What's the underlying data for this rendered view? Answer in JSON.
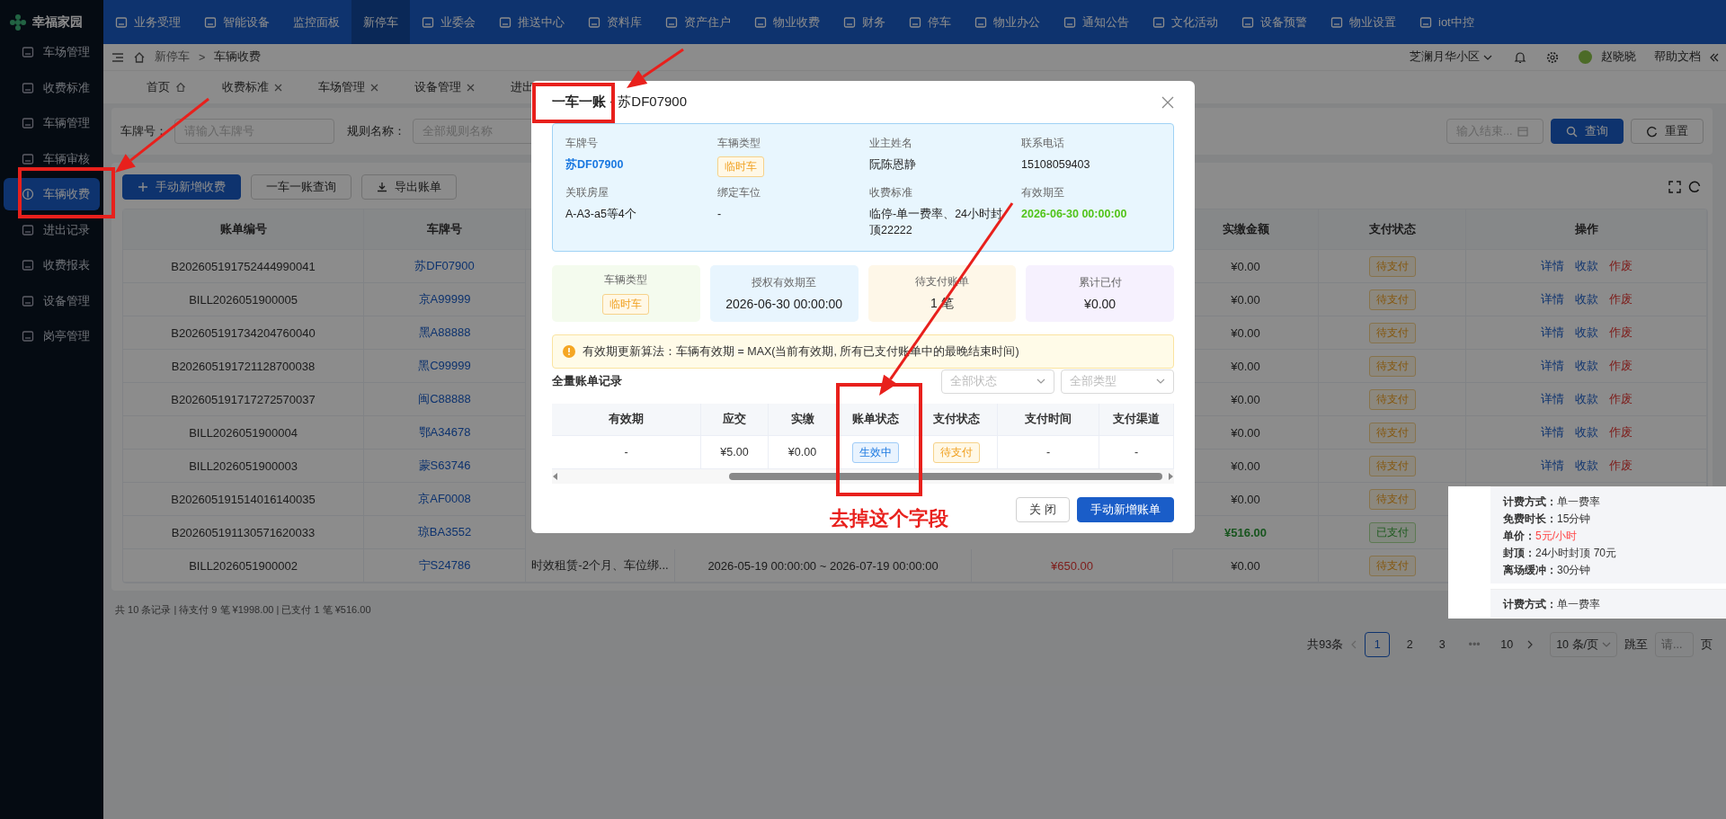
{
  "app": {
    "name": "幸福家园"
  },
  "top_nav": [
    {
      "label": "业务受理",
      "selected": false,
      "has_icon": true
    },
    {
      "label": "智能设备",
      "selected": false,
      "has_icon": true
    },
    {
      "label": "监控面板",
      "selected": false,
      "has_icon": false
    },
    {
      "label": "新停车",
      "selected": true,
      "has_icon": false
    },
    {
      "label": "业委会",
      "selected": false,
      "has_icon": true
    },
    {
      "label": "推送中心",
      "selected": false,
      "has_icon": true
    },
    {
      "label": "资料库",
      "selected": false,
      "has_icon": true
    },
    {
      "label": "资产住户",
      "selected": false,
      "has_icon": true
    },
    {
      "label": "物业收费",
      "selected": false,
      "has_icon": true
    },
    {
      "label": "财务",
      "selected": false,
      "has_icon": true
    },
    {
      "label": "停车",
      "selected": false,
      "has_icon": true
    },
    {
      "label": "物业办公",
      "selected": false,
      "has_icon": true
    },
    {
      "label": "通知公告",
      "selected": false,
      "has_icon": true
    },
    {
      "label": "文化活动",
      "selected": false,
      "has_icon": true
    },
    {
      "label": "设备预警",
      "selected": false,
      "has_icon": true
    },
    {
      "label": "物业设置",
      "selected": false,
      "has_icon": true
    },
    {
      "label": "iot中控",
      "selected": false,
      "has_icon": true
    }
  ],
  "sidebar": {
    "items": [
      {
        "label": "车场管理",
        "selected": false
      },
      {
        "label": "收费标准",
        "selected": false
      },
      {
        "label": "车辆管理",
        "selected": false
      },
      {
        "label": "车辆审核",
        "selected": false
      },
      {
        "label": "车辆收费",
        "selected": true
      },
      {
        "label": "进出记录",
        "selected": false
      },
      {
        "label": "收费报表",
        "selected": false
      },
      {
        "label": "设备管理",
        "selected": false
      },
      {
        "label": "岗亭管理",
        "selected": false
      }
    ]
  },
  "breadcrumb": {
    "items": [
      "新停车",
      "车辆收费"
    ],
    "separator": ">"
  },
  "header_right": {
    "community": "芝澜月华小区",
    "user": "赵晓晓",
    "help": "帮助文档"
  },
  "page_tabs": [
    {
      "label": "首页",
      "selected": false,
      "closable": false
    },
    {
      "label": "收费标准",
      "selected": false,
      "closable": true
    },
    {
      "label": "车场管理",
      "selected": false,
      "closable": true
    },
    {
      "label": "设备管理",
      "selected": false,
      "closable": true
    },
    {
      "label": "进出",
      "selected": false,
      "closable": false
    }
  ],
  "filters": [
    {
      "label": "车牌号：",
      "placeholder": "请输入车牌号",
      "kind": "text"
    },
    {
      "label": "规则名称：",
      "placeholder": "全部规则名称",
      "kind": "text"
    },
    {
      "placeholder": "输入结束...",
      "kind": "date"
    }
  ],
  "filter_buttons": [
    {
      "label": "查询",
      "kind": "search"
    },
    {
      "label": "重置",
      "kind": "reset"
    }
  ],
  "toolbar": [
    {
      "label": "手动新增收费",
      "kind": "primary"
    },
    {
      "label": "一车一账查询",
      "kind": "default"
    },
    {
      "label": "导出账单",
      "kind": "export"
    }
  ],
  "table": {
    "columns_left": [
      "账单编号",
      "车牌号"
    ],
    "columns_right": [
      "实缴金额",
      "支付状态",
      "操作"
    ],
    "rows": [
      {
        "bill": "B202605191752444990041",
        "plate": "苏DF07900",
        "paid": "¥0.00",
        "status": {
          "label": "待支付",
          "kind": "pending"
        },
        "actions": [
          {
            "label": "详情",
            "kind": "link"
          },
          {
            "label": "收款",
            "kind": "link"
          },
          {
            "label": "作废",
            "kind": "danger"
          }
        ]
      },
      {
        "bill": "BILL2026051900005",
        "plate": "京A99999",
        "paid": "¥0.00",
        "status": {
          "label": "待支付",
          "kind": "pending"
        },
        "actions": [
          {
            "label": "详情",
            "kind": "link"
          },
          {
            "label": "收款",
            "kind": "link"
          },
          {
            "label": "作废",
            "kind": "danger"
          }
        ]
      },
      {
        "bill": "B202605191734204760040",
        "plate": "黑A88888",
        "paid": "¥0.00",
        "status": {
          "label": "待支付",
          "kind": "pending"
        },
        "actions": [
          {
            "label": "详情",
            "kind": "link"
          },
          {
            "label": "收款",
            "kind": "link"
          },
          {
            "label": "作废",
            "kind": "danger"
          }
        ]
      },
      {
        "bill": "B202605191721128700038",
        "plate": "黑C99999",
        "paid": "¥0.00",
        "status": {
          "label": "待支付",
          "kind": "pending"
        },
        "actions": [
          {
            "label": "详情",
            "kind": "link"
          },
          {
            "label": "收款",
            "kind": "link"
          },
          {
            "label": "作废",
            "kind": "danger"
          }
        ]
      },
      {
        "bill": "B202605191717272570037",
        "plate": "闽C88888",
        "paid": "¥0.00",
        "status": {
          "label": "待支付",
          "kind": "pending"
        },
        "actions": [
          {
            "label": "详情",
            "kind": "link"
          },
          {
            "label": "收款",
            "kind": "link"
          },
          {
            "label": "作废",
            "kind": "danger"
          }
        ]
      },
      {
        "bill": "BILL2026051900004",
        "plate": "鄂A34678",
        "paid": "¥0.00",
        "status": {
          "label": "待支付",
          "kind": "pending"
        },
        "actions": [
          {
            "label": "详情",
            "kind": "link"
          },
          {
            "label": "收款",
            "kind": "link"
          },
          {
            "label": "作废",
            "kind": "danger"
          }
        ]
      },
      {
        "bill": "BILL2026051900003",
        "plate": "蒙S63746",
        "paid": "¥0.00",
        "status": {
          "label": "待支付",
          "kind": "pending"
        },
        "actions": [
          {
            "label": "详情",
            "kind": "link"
          },
          {
            "label": "收款",
            "kind": "link"
          },
          {
            "label": "作废",
            "kind": "danger"
          }
        ]
      },
      {
        "bill": "B202605191514016140035",
        "plate": "京AF0008",
        "paid": "¥0.00",
        "status": {
          "label": "待支付",
          "kind": "pending"
        }
      },
      {
        "bill": "B202605191130571620033",
        "plate": "琼BA3552",
        "paid": "¥516.00",
        "status": {
          "label": "已支付",
          "kind": "paid"
        }
      },
      {
        "bill": "BILL2026051900002",
        "plate": "宁S24786",
        "column_3": "时效租赁-2个月、车位绑...",
        "column_4": "2026-05-19 00:00:00 ~ 2026-07-19 00:00:00",
        "column_5": "¥650.00",
        "paid": "¥0.00",
        "status": {
          "label": "待支付",
          "kind": "pending"
        }
      }
    ]
  },
  "summary": "共 10 条记录 | 待支付 9 笔 ¥1998.00 | 已支付 1 笔 ¥516.00",
  "pagination": {
    "total": "共93条",
    "pages": [
      {
        "label": "1",
        "kind": "page",
        "selected": true
      },
      {
        "label": "2",
        "kind": "page",
        "selected": false
      },
      {
        "label": "3",
        "kind": "page",
        "selected": false
      },
      {
        "label": "•••",
        "kind": "ellipsis",
        "selected": false
      },
      {
        "label": "10",
        "kind": "page",
        "selected": false
      }
    ],
    "page_size": "10 条/页",
    "jump_label": "跳至",
    "jump_placeholder": "请...",
    "page_suffix": "页"
  },
  "popover": {
    "groups": [
      [
        {
          "label": "计费方式：",
          "value": "单一费率",
          "highlight": false
        },
        {
          "label": "免费时长：",
          "value": "15分钟",
          "highlight": false
        },
        {
          "label": "单价：",
          "value": "5元/小时",
          "highlight": true
        },
        {
          "label": "封顶：",
          "value": "24小时封顶 70元",
          "highlight": false
        },
        {
          "label": "离场缓冲：",
          "value": "30分钟",
          "highlight": false
        }
      ],
      [
        {
          "label": "计费方式：",
          "value": "单一费率",
          "highlight": false
        }
      ]
    ]
  },
  "modal": {
    "title": "**一车一账** - 苏DF07900",
    "info": [
      {
        "label": "车牌号",
        "value": "苏DF07900",
        "kind": "link"
      },
      {
        "label": "车辆类型",
        "value": "临时车",
        "kind": "tag"
      },
      {
        "label": "业主姓名",
        "value": "阮陈恩静",
        "kind": "text"
      },
      {
        "label": "联系电话",
        "value": "15108059403",
        "kind": "text"
      },
      {
        "label": "关联房屋",
        "value": "A-A3-a5等4个",
        "kind": "text"
      },
      {
        "label": "绑定车位",
        "value": "-",
        "kind": "text"
      },
      {
        "label": "收费标准",
        "value": "临停-单一费率、24小时封顶22222",
        "kind": "text"
      },
      {
        "label": "有效期至",
        "value": "2026-06-30 00:00:00",
        "kind": "success"
      }
    ],
    "stats": [
      {
        "label": "车辆类型",
        "value": "临时车",
        "kind": "tag",
        "color": "#f4fbee"
      },
      {
        "label": "授权有效期至",
        "value": "2026-06-30 00:00:00",
        "kind": "text",
        "color": "#e8f5fe"
      },
      {
        "label": "待支付账单",
        "value": "1 笔",
        "kind": "text",
        "color": "#fef7e8"
      },
      {
        "label": "累计已付",
        "value": "¥0.00",
        "kind": "text",
        "color": "#f6f1fe"
      }
    ],
    "notice": "有效期更新算法：车辆有效期 = MAX(当前有效期, 所有已支付账单中的最晚结束时间)",
    "records": {
      "title": "全量账单记录",
      "filters": [
        "全部状态",
        "全部类型"
      ],
      "columns": [
        "有效期",
        "应交",
        "实缴",
        "账单状态",
        "支付状态",
        "支付时间",
        "支付渠道"
      ],
      "rows": [
        [
          {
            "text": "-",
            "kind": "text"
          },
          {
            "text": "¥5.00",
            "kind": "text"
          },
          {
            "text": "¥0.00",
            "kind": "text"
          },
          {
            "text": "生效中",
            "kind": "active"
          },
          {
            "text": "待支付",
            "kind": "pending"
          },
          {
            "text": "-",
            "kind": "text"
          },
          {
            "text": "-",
            "kind": "text"
          }
        ]
      ]
    },
    "buttons": [
      {
        "label": "关 闭",
        "kind": "default"
      },
      {
        "label": "手动新增账单",
        "kind": "primary"
      }
    ]
  },
  "annotation": {
    "note": "去掉这个字段"
  }
}
